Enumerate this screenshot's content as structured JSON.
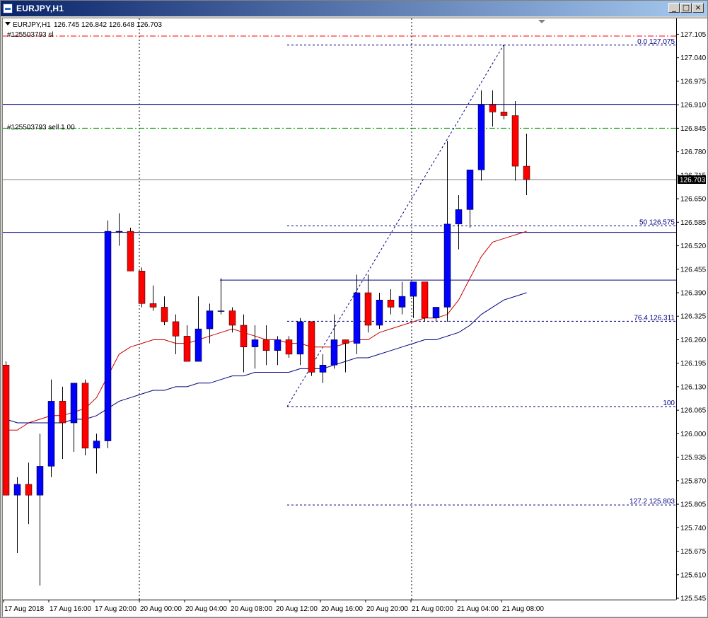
{
  "window": {
    "title": "EURJPY,H1",
    "buttons": {
      "minimize": "_",
      "restore": "□",
      "close": "×"
    }
  },
  "info": {
    "symbol": "EURJPY,H1",
    "ohlc": "126.745 126.842 126.648 126.703",
    "order_sl_label": "#125503793 sl",
    "order_label": "#125503793 sell 1.00"
  },
  "price_axis": {
    "ticks": [
      "127.105",
      "127.040",
      "126.975",
      "126.910",
      "126.845",
      "126.780",
      "126.715",
      "126.650",
      "126.585",
      "126.520",
      "126.455",
      "126.390",
      "126.325",
      "126.260",
      "126.195",
      "126.130",
      "126.065",
      "126.000",
      "125.935",
      "125.870",
      "125.805",
      "125.740",
      "125.675",
      "125.610",
      "125.545"
    ],
    "current_price": "126.703"
  },
  "time_axis": {
    "labels": [
      "17 Aug 2018",
      "17 Aug 16:00",
      "17 Aug 20:00",
      "20 Aug 00:00",
      "20 Aug 04:00",
      "20 Aug 08:00",
      "20 Aug 12:00",
      "20 Aug 16:00",
      "20 Aug 20:00",
      "21 Aug 00:00",
      "21 Aug 04:00",
      "21 Aug 08:00"
    ]
  },
  "fibonacci": {
    "levels": [
      {
        "label": "0.0 127.075",
        "price": 127.075
      },
      {
        "label": "50 126.575",
        "price": 126.575
      },
      {
        "label": "76.4 126.311",
        "price": 126.311
      },
      {
        "label": "100",
        "price": 126.075
      },
      {
        "label": "127.2 125.803",
        "price": 125.803
      }
    ]
  },
  "lines": {
    "sl_price": 127.1,
    "order_price": 126.845,
    "current_price": 126.703,
    "hlines": [
      126.911,
      126.557,
      126.425
    ]
  },
  "colors": {
    "bull": "#0000ff",
    "bear": "#ff0000",
    "ma_fast": "#cc0000",
    "ma_slow": "#000080",
    "sl_line": "#ff0000",
    "order_line": "#00a000",
    "hline": "#000080",
    "fib": "#000080",
    "vgrid": "#000000"
  },
  "chart_data": {
    "type": "candlestick",
    "symbol": "EURJPY",
    "timeframe": "H1",
    "ylim": [
      125.545,
      127.145
    ],
    "candles": [
      {
        "o": 126.19,
        "h": 126.2,
        "l": 125.83,
        "c": 125.83
      },
      {
        "o": 125.83,
        "h": 125.88,
        "l": 125.67,
        "c": 125.86
      },
      {
        "o": 125.86,
        "h": 125.92,
        "l": 125.75,
        "c": 125.83
      },
      {
        "o": 125.83,
        "h": 126.0,
        "l": 125.58,
        "c": 125.91
      },
      {
        "o": 125.91,
        "h": 126.15,
        "l": 125.88,
        "c": 126.09
      },
      {
        "o": 126.09,
        "h": 126.13,
        "l": 125.93,
        "c": 126.03
      },
      {
        "o": 126.03,
        "h": 126.14,
        "l": 125.95,
        "c": 126.14
      },
      {
        "o": 126.14,
        "h": 126.15,
        "l": 125.94,
        "c": 125.96
      },
      {
        "o": 125.96,
        "h": 126.0,
        "l": 125.89,
        "c": 125.98
      },
      {
        "o": 125.98,
        "h": 126.59,
        "l": 125.96,
        "c": 126.56
      },
      {
        "o": 126.56,
        "h": 126.61,
        "l": 126.52,
        "c": 126.56
      },
      {
        "o": 126.56,
        "h": 126.57,
        "l": 126.45,
        "c": 126.45
      },
      {
        "o": 126.45,
        "h": 126.46,
        "l": 126.35,
        "c": 126.36
      },
      {
        "o": 126.36,
        "h": 126.41,
        "l": 126.34,
        "c": 126.35
      },
      {
        "o": 126.35,
        "h": 126.38,
        "l": 126.3,
        "c": 126.31
      },
      {
        "o": 126.31,
        "h": 126.33,
        "l": 126.22,
        "c": 126.27
      },
      {
        "o": 126.27,
        "h": 126.3,
        "l": 126.22,
        "c": 126.2
      },
      {
        "o": 126.2,
        "h": 126.38,
        "l": 126.21,
        "c": 126.29
      },
      {
        "o": 126.29,
        "h": 126.36,
        "l": 126.25,
        "c": 126.34
      },
      {
        "o": 126.34,
        "h": 126.43,
        "l": 126.33,
        "c": 126.34
      },
      {
        "o": 126.34,
        "h": 126.35,
        "l": 126.28,
        "c": 126.3
      },
      {
        "o": 126.3,
        "h": 126.33,
        "l": 126.17,
        "c": 126.24
      },
      {
        "o": 126.24,
        "h": 126.3,
        "l": 126.18,
        "c": 126.26
      },
      {
        "o": 126.26,
        "h": 126.3,
        "l": 126.19,
        "c": 126.23
      },
      {
        "o": 126.23,
        "h": 126.27,
        "l": 126.19,
        "c": 126.26
      },
      {
        "o": 126.26,
        "h": 126.27,
        "l": 126.21,
        "c": 126.22
      },
      {
        "o": 126.22,
        "h": 126.32,
        "l": 126.19,
        "c": 126.31
      },
      {
        "o": 126.31,
        "h": 126.31,
        "l": 126.16,
        "c": 126.17
      },
      {
        "o": 126.17,
        "h": 126.22,
        "l": 126.14,
        "c": 126.19
      },
      {
        "o": 126.19,
        "h": 126.33,
        "l": 126.18,
        "c": 126.26
      },
      {
        "o": 126.26,
        "h": 126.26,
        "l": 126.17,
        "c": 126.25
      },
      {
        "o": 126.25,
        "h": 126.44,
        "l": 126.22,
        "c": 126.39
      },
      {
        "o": 126.39,
        "h": 126.44,
        "l": 126.28,
        "c": 126.3
      },
      {
        "o": 126.3,
        "h": 126.39,
        "l": 126.29,
        "c": 126.37
      },
      {
        "o": 126.37,
        "h": 126.4,
        "l": 126.33,
        "c": 126.35
      },
      {
        "o": 126.35,
        "h": 126.42,
        "l": 126.33,
        "c": 126.38
      },
      {
        "o": 126.38,
        "h": 126.41,
        "l": 126.32,
        "c": 126.42
      },
      {
        "o": 126.42,
        "h": 126.42,
        "l": 126.31,
        "c": 126.32
      },
      {
        "o": 126.32,
        "h": 126.33,
        "l": 126.31,
        "c": 126.35
      },
      {
        "o": 126.35,
        "h": 126.81,
        "l": 126.31,
        "c": 126.58
      },
      {
        "o": 126.58,
        "h": 126.66,
        "l": 126.51,
        "c": 126.62
      },
      {
        "o": 126.62,
        "h": 126.73,
        "l": 126.57,
        "c": 126.73
      },
      {
        "o": 126.73,
        "h": 126.95,
        "l": 126.7,
        "c": 126.91
      },
      {
        "o": 126.91,
        "h": 126.95,
        "l": 126.85,
        "c": 126.89
      },
      {
        "o": 126.89,
        "h": 127.075,
        "l": 126.87,
        "c": 126.88
      },
      {
        "o": 126.88,
        "h": 126.92,
        "l": 126.7,
        "c": 126.74
      },
      {
        "o": 126.74,
        "h": 126.83,
        "l": 126.66,
        "c": 126.703
      }
    ],
    "ma_fast": [
      126.01,
      126.01,
      126.03,
      126.04,
      126.05,
      126.05,
      126.06,
      126.07,
      126.1,
      126.16,
      126.22,
      126.24,
      126.25,
      126.26,
      126.26,
      126.25,
      126.25,
      126.26,
      126.27,
      126.28,
      126.29,
      126.28,
      126.27,
      126.26,
      126.26,
      126.25,
      126.25,
      126.24,
      126.24,
      126.24,
      126.25,
      126.26,
      126.26,
      126.28,
      126.29,
      126.3,
      126.31,
      126.32,
      126.32,
      126.33,
      126.37,
      126.43,
      126.49,
      126.53,
      126.54,
      126.55,
      126.56
    ],
    "ma_slow": [
      126.04,
      126.03,
      126.03,
      126.03,
      126.03,
      126.03,
      126.04,
      126.04,
      126.05,
      126.07,
      126.09,
      126.1,
      126.11,
      126.12,
      126.12,
      126.13,
      126.13,
      126.14,
      126.14,
      126.15,
      126.16,
      126.16,
      126.17,
      126.17,
      126.17,
      126.17,
      126.18,
      126.18,
      126.18,
      126.19,
      126.2,
      126.21,
      126.21,
      126.22,
      126.23,
      126.24,
      126.25,
      126.26,
      126.26,
      126.27,
      126.28,
      126.3,
      126.33,
      126.35,
      126.37,
      126.38,
      126.39
    ]
  }
}
